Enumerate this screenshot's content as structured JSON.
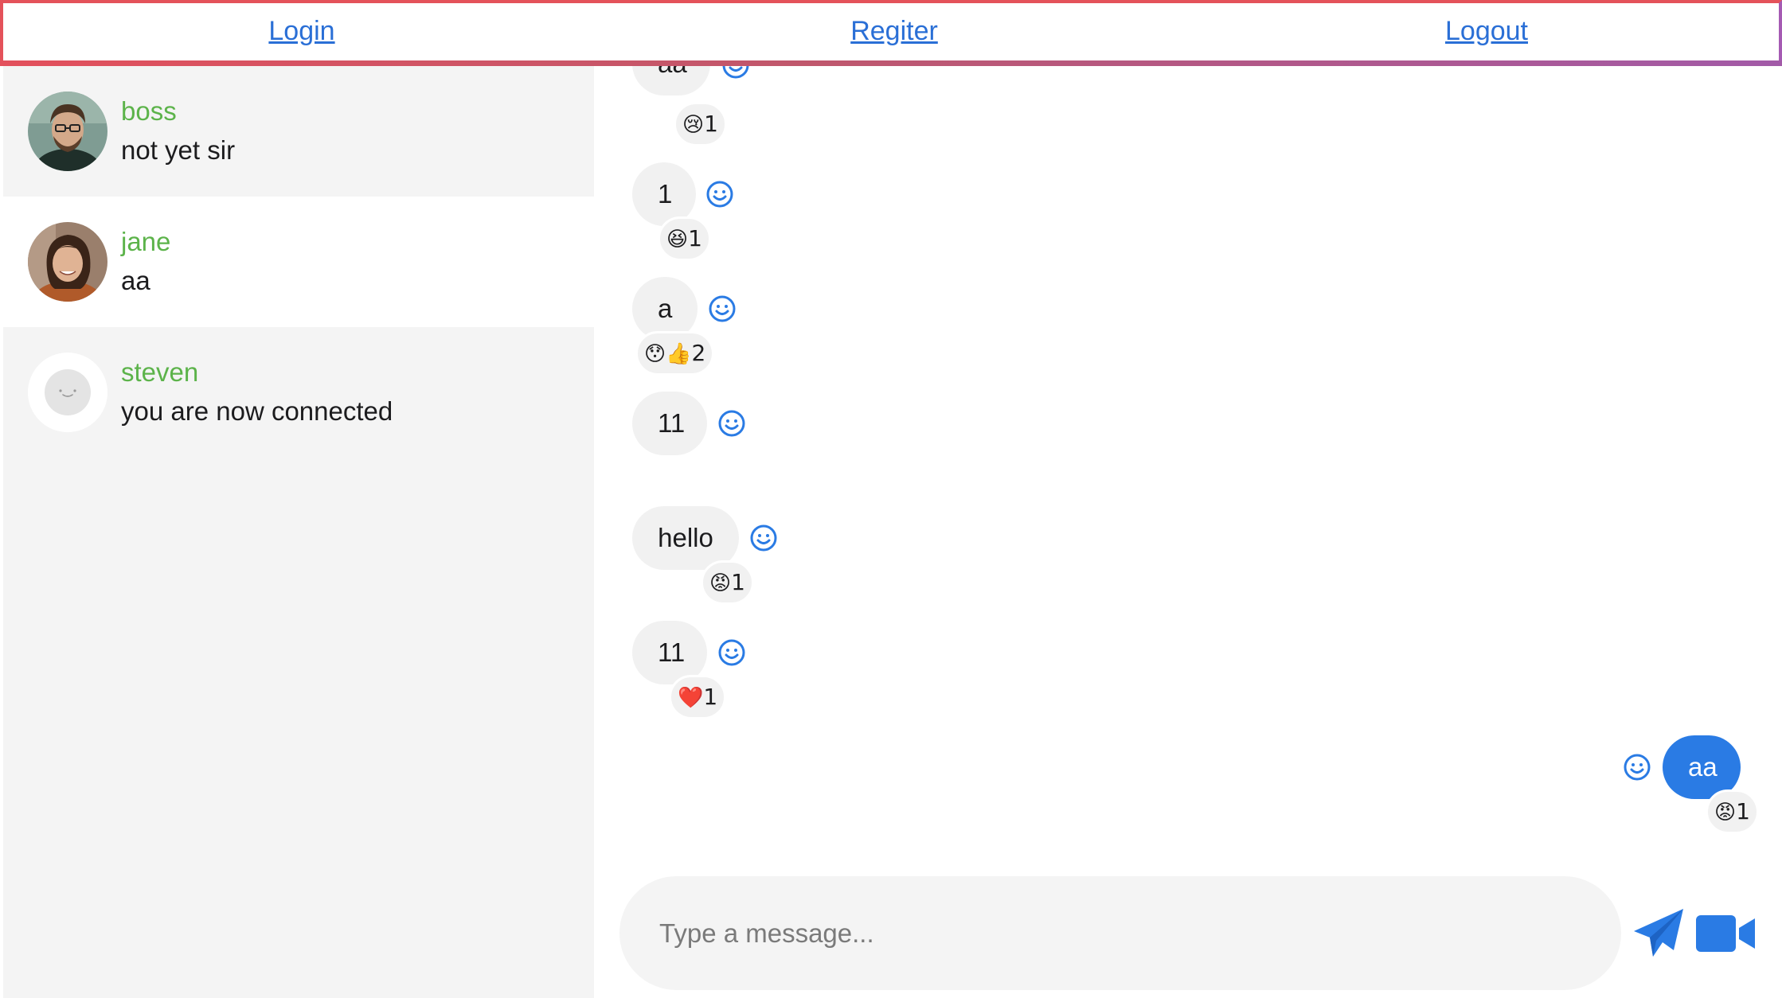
{
  "nav": {
    "login": "Login",
    "register": "Regiter",
    "logout": "Logout"
  },
  "conversations": [
    {
      "name": "boss",
      "last_message": "not yet sir",
      "avatar": "photo-man-avatar",
      "active": false
    },
    {
      "name": "jane",
      "last_message": "aa",
      "avatar": "photo-woman-avatar",
      "active": true
    },
    {
      "name": "steven",
      "last_message": "you are now connected",
      "avatar": "default-avatar",
      "active": false
    }
  ],
  "messages": [
    {
      "text": "aa",
      "from": "other",
      "reaction": {
        "emoji": "😢",
        "count": "1"
      }
    },
    {
      "text": "1",
      "from": "other",
      "reaction": {
        "emoji": "😆",
        "count": "1"
      }
    },
    {
      "text": "a",
      "from": "other",
      "reaction": {
        "emoji": "😯👍",
        "count": "2"
      }
    },
    {
      "text": "11",
      "from": "other",
      "reaction": null
    },
    {
      "text": "hello",
      "from": "other",
      "reaction": {
        "emoji": "😡",
        "count": "1"
      }
    },
    {
      "text": "11",
      "from": "other",
      "reaction": {
        "emoji": "❤️",
        "count": "1"
      }
    },
    {
      "text": "aa",
      "from": "me",
      "reaction": {
        "emoji": "😡",
        "count": "1"
      }
    }
  ],
  "composer": {
    "placeholder": "Type a message..."
  },
  "icons": {
    "add_reaction": "smiley-icon",
    "send": "paper-plane-icon",
    "video": "video-camera-icon"
  },
  "colors": {
    "accent": "#2a7be4",
    "link": "#2a6fd6",
    "name": "#5cb34a",
    "sidebar_bg": "#f4f4f4",
    "bubble_bg": "#f1f1f1"
  }
}
